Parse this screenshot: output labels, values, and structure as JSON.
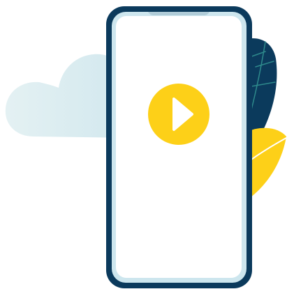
{
  "illustration": {
    "subject": "phone-video-player",
    "icons": [
      "cloud-icon",
      "leaf-icon",
      "phone-icon",
      "play-icon"
    ]
  },
  "colors": {
    "phone_frame": "#0b3a5c",
    "phone_screen": "#ffffff",
    "phone_bezel_inner": "#cde6ee",
    "play_button": "#fdd018",
    "play_triangle": "#ffffff",
    "cloud": "#dcedf1",
    "leaf_dark": "#0b3a5c",
    "leaf_dark_vein": "#2e8a8c",
    "leaf_yellow": "#fdd018",
    "leaf_yellow_vein": "#ffffff"
  }
}
